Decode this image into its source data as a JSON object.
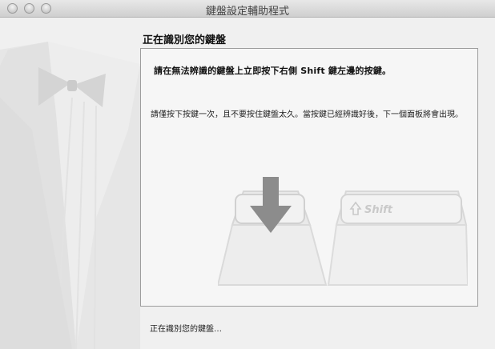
{
  "window": {
    "title": "鍵盤設定輔助程式",
    "traffic_lights": [
      "close",
      "minimize",
      "zoom"
    ]
  },
  "main": {
    "heading": "正在識別您的鍵盤",
    "instruction": "請在無法辨識的鍵盤上立即按下右側 Shift 鍵左邊的按鍵。",
    "description": "請僅按下按鍵一次，且不要按住鍵盤太久。當按鍵已經辨識好後，下一個面板將會出現。",
    "illustration": {
      "target_key_label": "",
      "shift_key_label": "Shift",
      "arrow_icon": "down-arrow-icon",
      "shift_icon": "shift-arrow-icon"
    }
  },
  "footer": {
    "status": "正在識別您的鍵盤…"
  }
}
